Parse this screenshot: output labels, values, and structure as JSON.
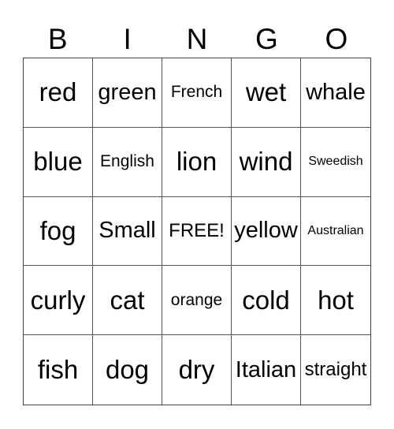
{
  "header": [
    "B",
    "I",
    "N",
    "G",
    "O"
  ],
  "cells": [
    {
      "text": "red",
      "size": "xl"
    },
    {
      "text": "green",
      "size": "l"
    },
    {
      "text": "French",
      "size": "s"
    },
    {
      "text": "wet",
      "size": "xl"
    },
    {
      "text": "whale",
      "size": "l"
    },
    {
      "text": "blue",
      "size": "xl"
    },
    {
      "text": "English",
      "size": "s"
    },
    {
      "text": "lion",
      "size": "xl"
    },
    {
      "text": "wind",
      "size": "xl"
    },
    {
      "text": "Sweedish",
      "size": "xs"
    },
    {
      "text": "fog",
      "size": "xl"
    },
    {
      "text": "Small",
      "size": "l"
    },
    {
      "text": "FREE!",
      "size": "m"
    },
    {
      "text": "yellow",
      "size": "l"
    },
    {
      "text": "Australian",
      "size": "xs"
    },
    {
      "text": "curly",
      "size": "xl"
    },
    {
      "text": "cat",
      "size": "xl"
    },
    {
      "text": "orange",
      "size": "s"
    },
    {
      "text": "cold",
      "size": "xl"
    },
    {
      "text": "hot",
      "size": "xl"
    },
    {
      "text": "fish",
      "size": "xl"
    },
    {
      "text": "dog",
      "size": "xl"
    },
    {
      "text": "dry",
      "size": "xl"
    },
    {
      "text": "Italian",
      "size": "l"
    },
    {
      "text": "straight",
      "size": "m"
    }
  ]
}
